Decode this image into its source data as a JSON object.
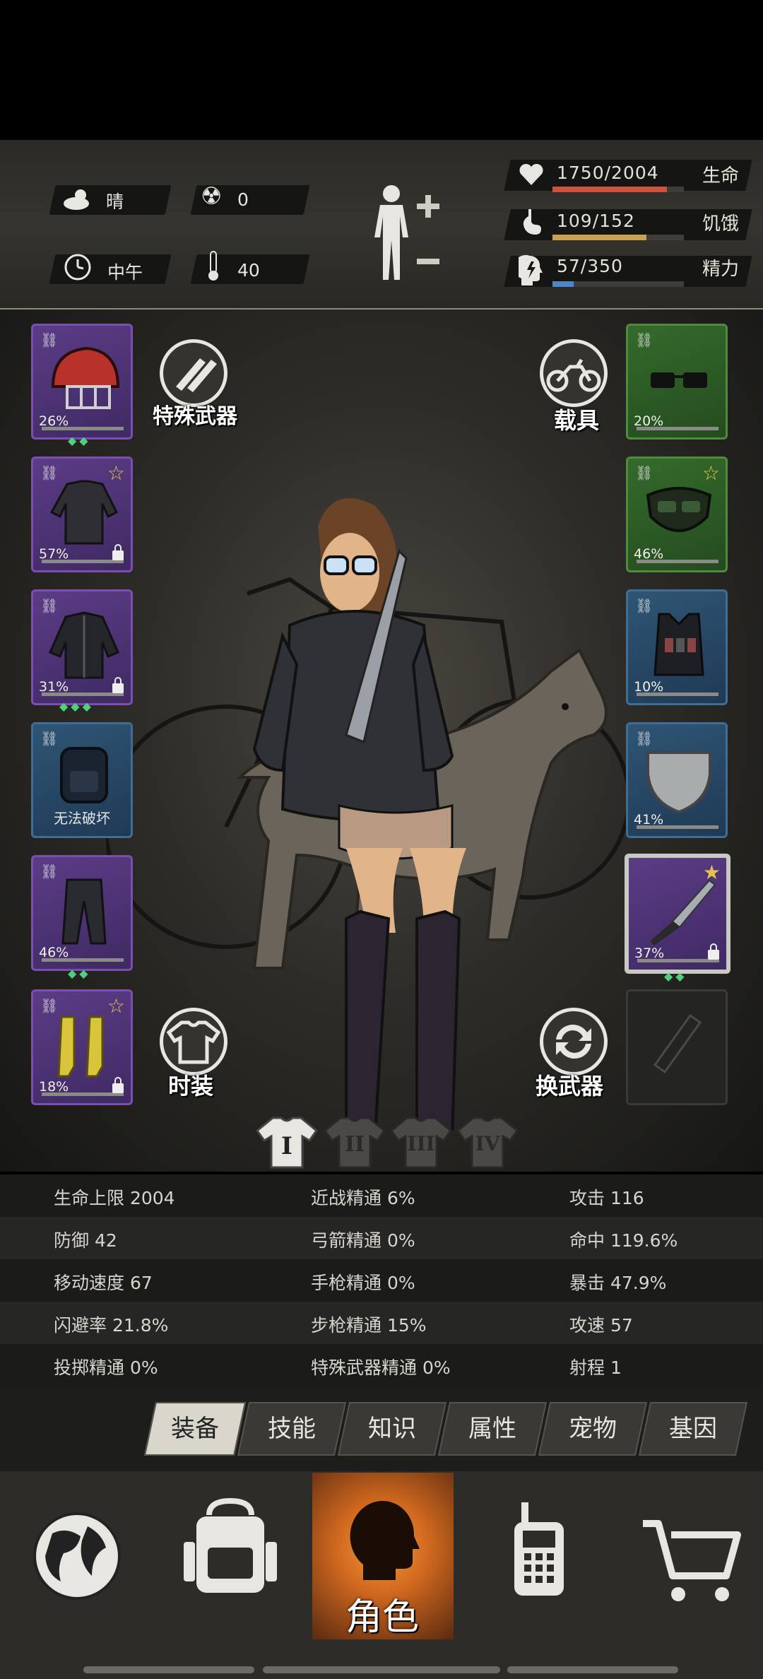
{
  "environment": {
    "weather": "晴",
    "radiation": "0",
    "time_of_day": "中午",
    "temperature": "40"
  },
  "vitals": [
    {
      "value": "1750/2004",
      "label": "生命",
      "fraction": 0.873,
      "color": "#d0513c"
    },
    {
      "value": "109/152",
      "label": "饥饿",
      "fraction": 0.717,
      "color": "#c8a150"
    },
    {
      "value": "57/350",
      "label": "精力",
      "fraction": 0.163,
      "color": "#4f86c6"
    }
  ],
  "left_slots": [
    {
      "name": "helmet",
      "pct": "26%",
      "gems": "◆◆",
      "rarity": "purple"
    },
    {
      "name": "shirt",
      "pct": "57%",
      "star": true,
      "locked": true,
      "rarity": "purple"
    },
    {
      "name": "jacket",
      "pct": "31%",
      "locked": true,
      "gems": "◆◆◆",
      "rarity": "purple"
    },
    {
      "name": "backpack",
      "text": "无法破坏",
      "rarity": "blue"
    },
    {
      "name": "pants",
      "pct": "46%",
      "gems": "◆◆",
      "rarity": "purple"
    },
    {
      "name": "boots",
      "pct": "18%",
      "star": true,
      "locked": true,
      "rarity": "purple"
    }
  ],
  "right_slots": [
    {
      "name": "glasses",
      "pct": "20%",
      "rarity": "green"
    },
    {
      "name": "mask",
      "pct": "46%",
      "star": true,
      "rarity": "green"
    },
    {
      "name": "vest",
      "pct": "10%",
      "rarity": "blue"
    },
    {
      "name": "shield",
      "pct": "41%",
      "rarity": "blue"
    },
    {
      "name": "knife",
      "pct": "37%",
      "star": true,
      "locked": true,
      "gems": "◆◆",
      "rarity": "purple"
    },
    {
      "name": "empty-weapon",
      "rarity": "gray"
    }
  ],
  "buttons": {
    "special_weapon": "特殊武器",
    "vehicle": "载具",
    "outfit": "时装",
    "swap_weapon": "换武器"
  },
  "outfit_tabs": [
    "I",
    "II",
    "III",
    "IV"
  ],
  "stats": [
    [
      "生命上限 2004",
      "近战精通 6%",
      "攻击 116"
    ],
    [
      "防御 42",
      "弓箭精通 0%",
      "命中 119.6%"
    ],
    [
      "移动速度 67",
      "手枪精通 0%",
      "暴击 47.9%"
    ],
    [
      "闪避率 21.8%",
      "步枪精通 15%",
      "攻速 57"
    ],
    [
      "投掷精通 0%",
      "特殊武器精通 0%",
      "射程 1"
    ]
  ],
  "category_tabs": [
    "装备",
    "技能",
    "知识",
    "属性",
    "宠物",
    "基因"
  ],
  "nav": {
    "character_label": "角色"
  }
}
